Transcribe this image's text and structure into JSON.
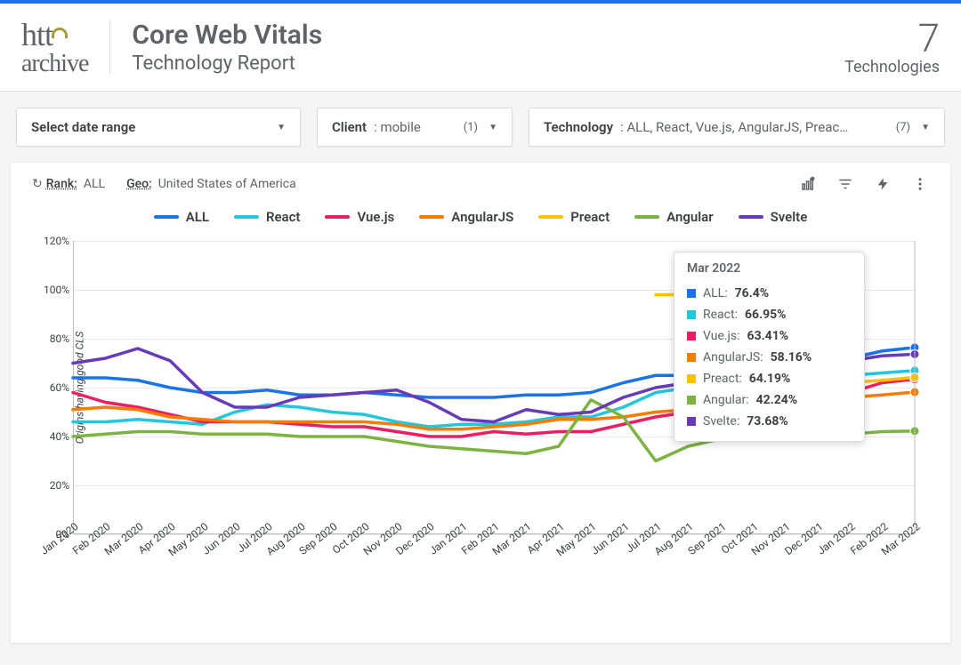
{
  "header": {
    "title": "Core Web Vitals",
    "subtitle": "Technology Report",
    "count_value": "7",
    "count_label": "Technologies"
  },
  "filters": {
    "date": {
      "label": "Select date range"
    },
    "client": {
      "label": "Client",
      "value": ": mobile",
      "count": "(1)"
    },
    "technology": {
      "label": "Technology",
      "value": ": ALL, React, Vue.js, AngularJS, Preac…",
      "count": "(7)"
    }
  },
  "chart_toolbar": {
    "rank_label": "Rank:",
    "rank_value": "ALL",
    "geo_label": "Geo:",
    "geo_value": "United States of America"
  },
  "tooltip": {
    "title": "Mar 2022",
    "rows": [
      {
        "name": "ALL",
        "value": "76.4%",
        "color": "#1a73e8"
      },
      {
        "name": "React",
        "value": "66.95%",
        "color": "#26c6da"
      },
      {
        "name": "Vue.js",
        "value": "63.41%",
        "color": "#e91e63"
      },
      {
        "name": "AngularJS",
        "value": "58.16%",
        "color": "#f57c00"
      },
      {
        "name": "Preact",
        "value": "64.19%",
        "color": "#ffc107"
      },
      {
        "name": "Angular",
        "value": "42.24%",
        "color": "#7cb342"
      },
      {
        "name": "Svelte",
        "value": "73.68%",
        "color": "#673ab7"
      }
    ]
  },
  "chart_data": {
    "type": "line",
    "title": "",
    "ylabel": "Origins having good CLS",
    "xlabel": "",
    "ylim": [
      0,
      120
    ],
    "yticks": [
      "0%",
      "20%",
      "40%",
      "60%",
      "80%",
      "100%",
      "120%"
    ],
    "categories": [
      "Jan 2020",
      "Feb 2020",
      "Mar 2020",
      "Apr 2020",
      "May 2020",
      "Jun 2020",
      "Jul 2020",
      "Aug 2020",
      "Sep 2020",
      "Oct 2020",
      "Nov 2020",
      "Dec 2020",
      "Jan 2021",
      "Feb 2021",
      "Mar 2021",
      "Apr 2021",
      "May 2021",
      "Jun 2021",
      "Jul 2021",
      "Aug 2021",
      "Sep 2021",
      "Oct 2021",
      "Nov 2021",
      "Dec 2021",
      "Jan 2022",
      "Feb 2022",
      "Mar 2022"
    ],
    "series": [
      {
        "name": "ALL",
        "color": "#1a73e8",
        "values": [
          64,
          64,
          63,
          60,
          58,
          58,
          59,
          57,
          57,
          58,
          57,
          56,
          56,
          56,
          57,
          57,
          58,
          62,
          65,
          65,
          66,
          67,
          67,
          68,
          72,
          75,
          76.4
        ]
      },
      {
        "name": "React",
        "color": "#26c6da",
        "values": [
          46,
          46,
          47,
          46,
          45,
          50,
          53,
          52,
          50,
          49,
          46,
          44,
          45,
          45,
          46,
          48,
          48,
          52,
          58,
          60,
          60,
          61,
          62,
          63,
          65,
          66,
          66.95
        ]
      },
      {
        "name": "Vue.js",
        "color": "#e91e63",
        "values": [
          58,
          54,
          52,
          49,
          46,
          46,
          46,
          45,
          44,
          44,
          42,
          40,
          40,
          42,
          41,
          42,
          42,
          45,
          48,
          50,
          51,
          52,
          53,
          54,
          58,
          62,
          63.41
        ]
      },
      {
        "name": "AngularJS",
        "color": "#f57c00",
        "values": [
          51,
          52,
          51,
          48,
          47,
          46,
          46,
          46,
          46,
          46,
          45,
          43,
          43,
          44,
          45,
          47,
          47,
          48,
          50,
          51,
          52,
          52,
          53,
          54,
          56,
          57,
          58.16
        ]
      },
      {
        "name": "Preact",
        "color": "#ffc107",
        "values": [
          null,
          null,
          null,
          null,
          null,
          null,
          null,
          null,
          null,
          null,
          null,
          null,
          null,
          null,
          null,
          null,
          null,
          null,
          98,
          98,
          99,
          101,
          86,
          65,
          62,
          63,
          64.19
        ]
      },
      {
        "name": "Angular",
        "color": "#7cb342",
        "values": [
          40,
          41,
          42,
          42,
          41,
          41,
          41,
          40,
          40,
          40,
          38,
          36,
          35,
          34,
          33,
          36,
          55,
          48,
          30,
          36,
          39,
          40,
          40,
          40,
          41,
          42,
          42.24
        ]
      },
      {
        "name": "Svelte",
        "color": "#673ab7",
        "values": [
          70,
          72,
          76,
          71,
          58,
          52,
          52,
          56,
          57,
          58,
          59,
          54,
          47,
          46,
          51,
          49,
          50,
          56,
          60,
          62,
          64,
          65,
          66,
          68,
          71,
          73,
          73.68
        ]
      }
    ]
  }
}
